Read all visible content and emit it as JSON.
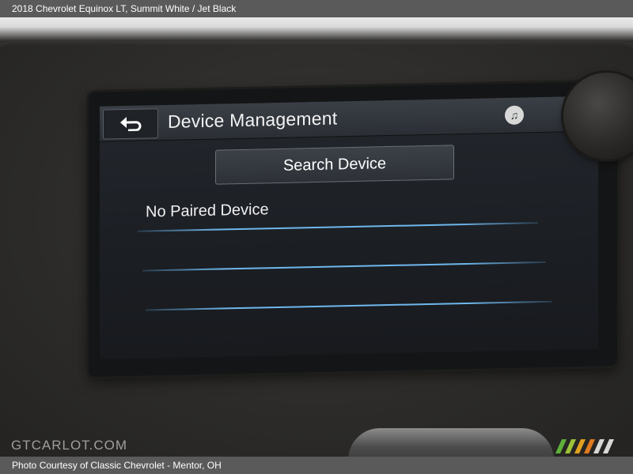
{
  "caption_top": "2018 Chevrolet Equinox LT,  Summit White / Jet Black",
  "caption_bottom": "Photo Courtesy of Classic Chevrolet - Mentor, OH",
  "watermark": "GTCARLOT.COM",
  "screen": {
    "back_icon": "back-arrow-icon",
    "title": "Device Management",
    "media_icon": "music-note-icon",
    "search_button_label": "Search Device",
    "status_text": "No Paired Device"
  },
  "colors": {
    "accent_line": "#6fb7ec",
    "screen_bg": "#1c1f24",
    "header_bg": "#2b2f35"
  }
}
